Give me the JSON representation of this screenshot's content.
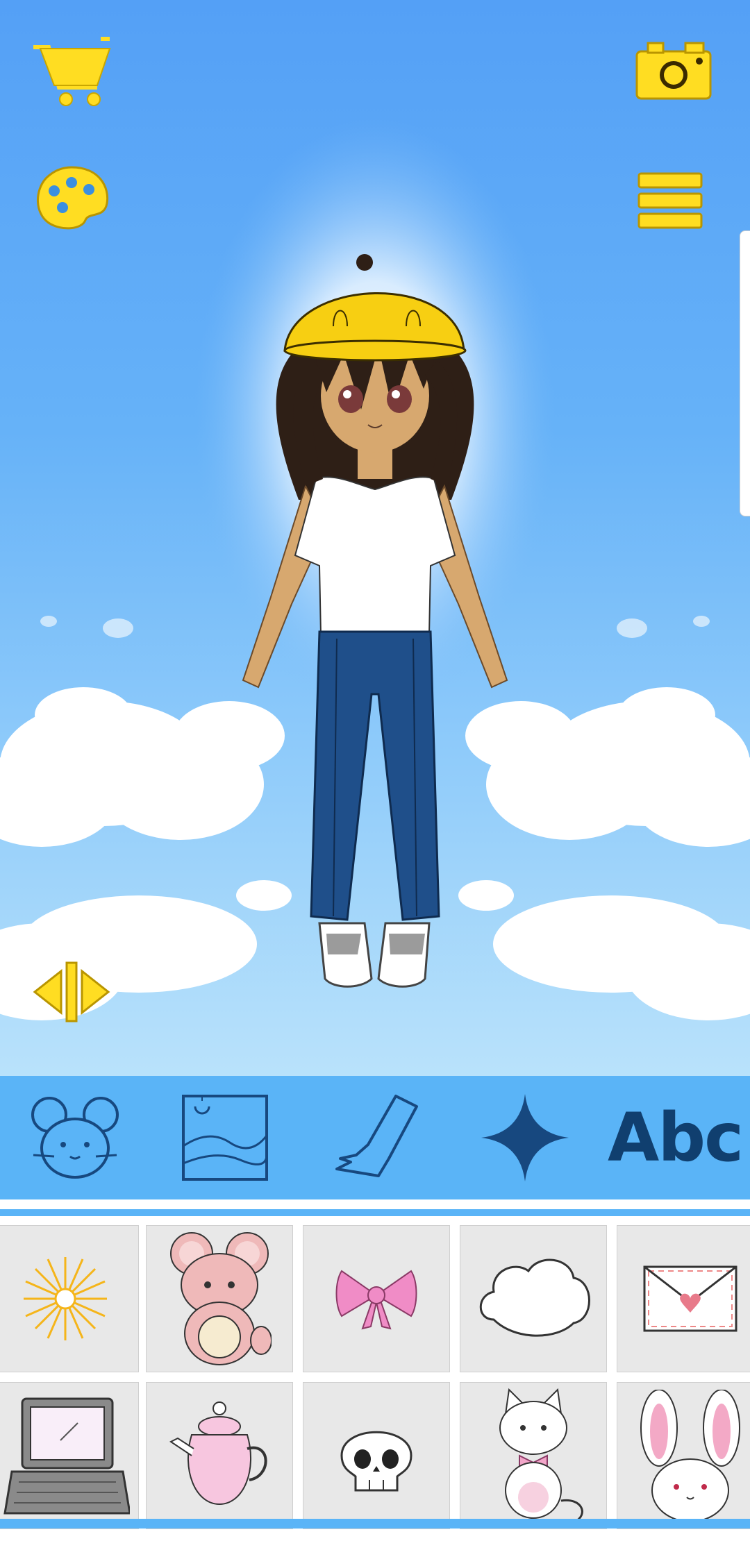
{
  "toolbar": {
    "shop_icon": "shopping-cart-icon",
    "camera_icon": "camera-icon",
    "palette_icon": "palette-icon",
    "menu_icon": "hamburger-menu-icon",
    "flip_icon": "flip-arrows-icon"
  },
  "categories": [
    {
      "icon": "mouse-icon"
    },
    {
      "icon": "landscape-background-icon"
    },
    {
      "icon": "glove-icon"
    },
    {
      "icon": "sparkle-icon"
    },
    {
      "label": "Abc"
    }
  ],
  "items": [
    {
      "icon": "sunburst-icon"
    },
    {
      "icon": "teddy-mouse-icon"
    },
    {
      "icon": "pink-bow-icon"
    },
    {
      "icon": "cloud-icon"
    },
    {
      "icon": "love-letter-icon"
    },
    {
      "icon": "laptop-icon"
    },
    {
      "icon": "teapot-icon"
    },
    {
      "icon": "skull-icon"
    },
    {
      "icon": "cat-plush-icon"
    },
    {
      "icon": "bunny-icon"
    }
  ],
  "colors": {
    "accent_yellow": "#ffdd22",
    "category_bar": "#5ab4f7",
    "category_icon": "#17487f",
    "sky_top": "#54a0f6",
    "tile_bg": "#e8e8e8"
  }
}
